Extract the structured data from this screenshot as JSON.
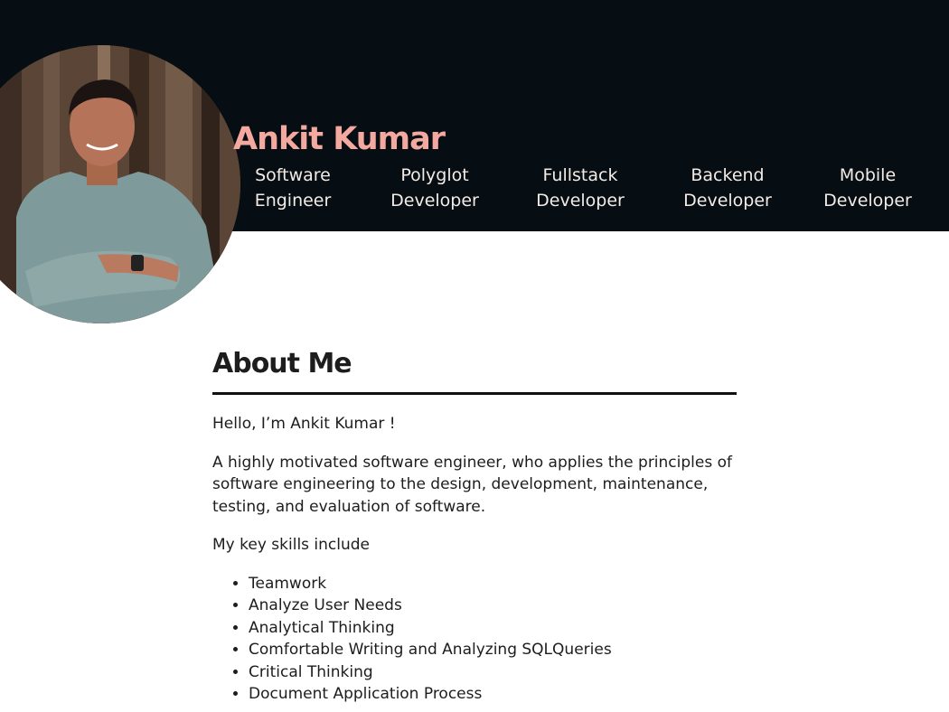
{
  "header": {
    "name": "Ankit Kumar",
    "roles": [
      "Software\nEngineer",
      "Polyglot\nDeveloper",
      "Fullstack\nDeveloper",
      "Backend\nDeveloper",
      "Mobile\nDeveloper"
    ]
  },
  "about": {
    "title": "About Me",
    "greeting": "Hello, I’m Ankit Kumar !",
    "description": "A highly motivated software engineer, who applies the principles of software engineering to the design, development, maintenance, testing, and evaluation of software.",
    "skills_intro": "My key skills include",
    "skills": [
      "Teamwork",
      "Analyze User Needs",
      "Analytical Thinking",
      "Comfortable Writing and Analyzing SQLQueries",
      "Critical Thinking",
      "Document Application Process"
    ]
  },
  "colors": {
    "header_bg": "#060e13",
    "name_accent": "#f4a9a0",
    "role_text": "#f3ece6",
    "body_text": "#1d1d1d"
  }
}
